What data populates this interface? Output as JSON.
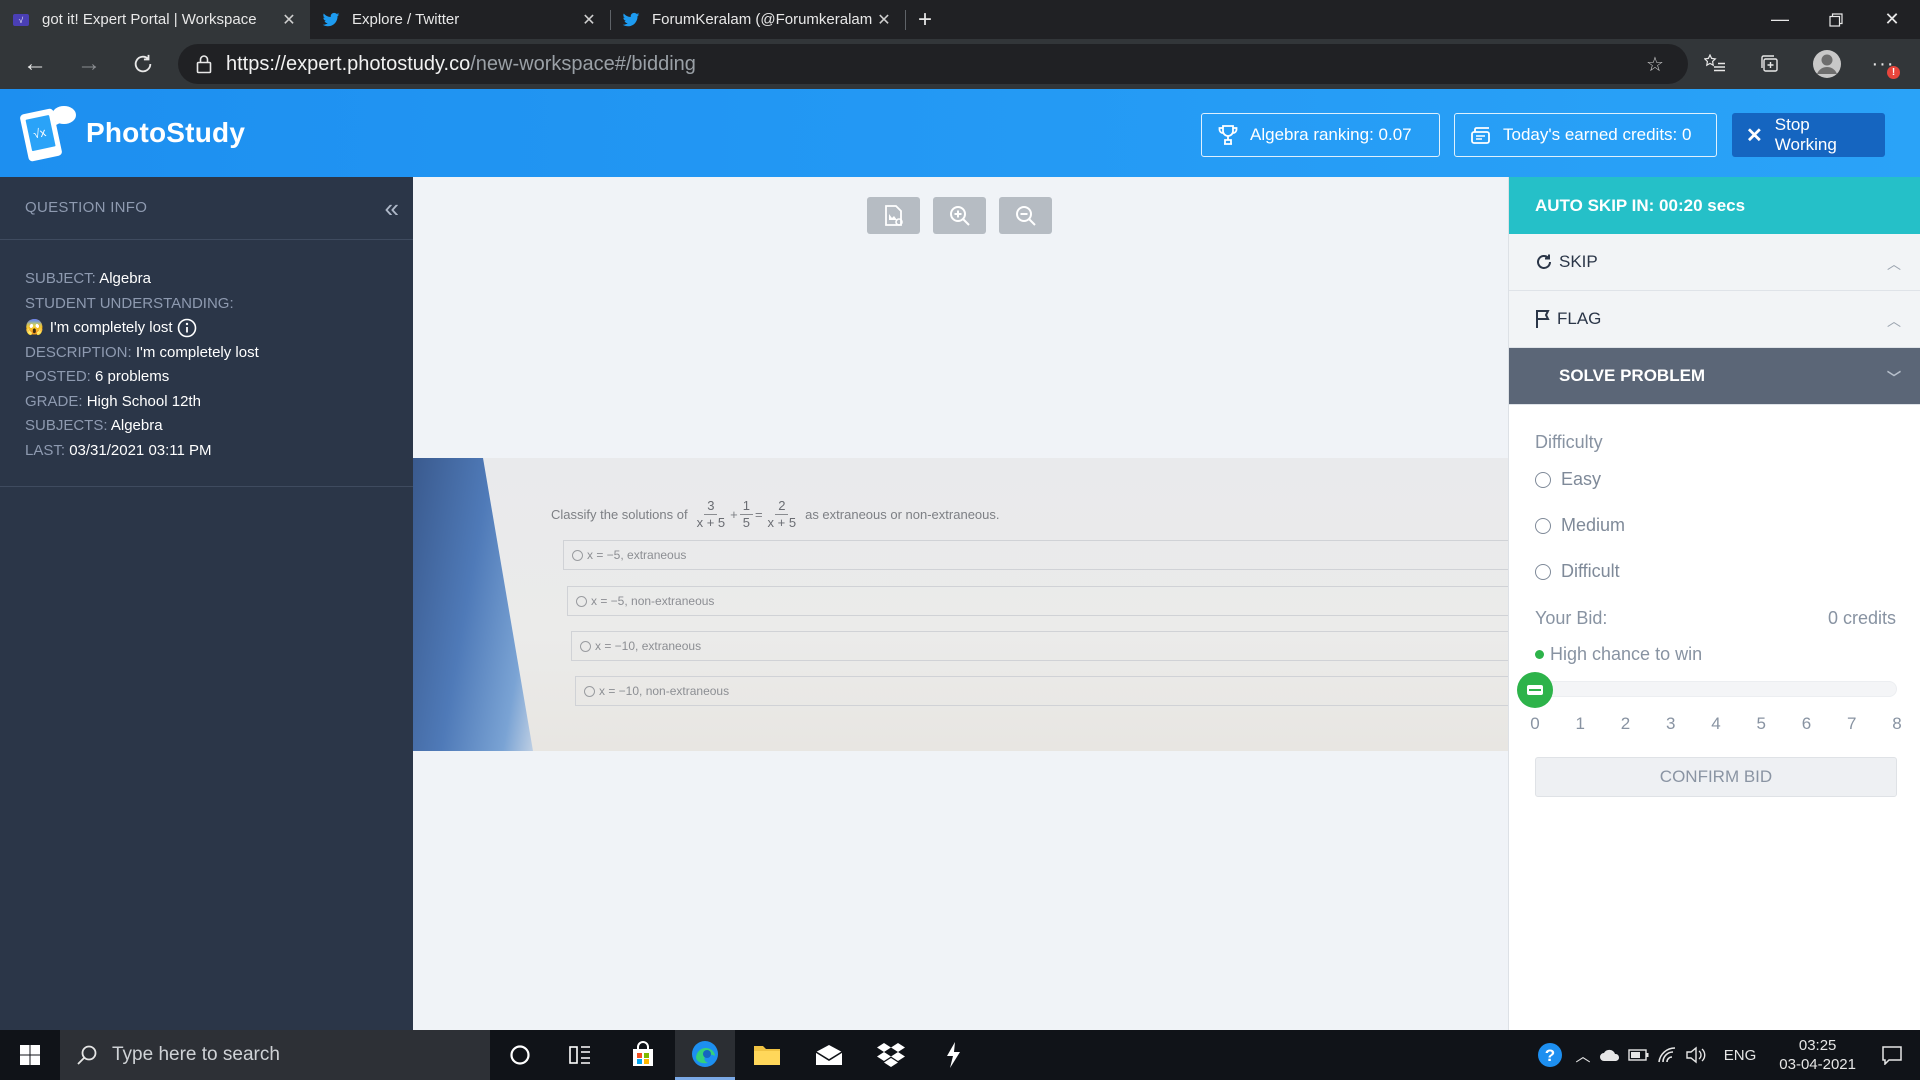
{
  "browser": {
    "tabs": [
      {
        "title": "got it! Expert Portal | Workspace",
        "icon": "gotit-favicon",
        "active": true
      },
      {
        "title": "Explore / Twitter",
        "icon": "twitter-favicon",
        "active": false
      },
      {
        "title": "ForumKeralam (@Forumkeralam",
        "icon": "twitter-favicon",
        "active": false
      }
    ],
    "url_host": "https://expert.photostudy.co",
    "url_path": "/new-workspace#/bidding",
    "notification_badge": "!"
  },
  "app": {
    "name": "PhotoStudy",
    "ranking_label": "Algebra ranking: 0.07",
    "credits_label": "Today's earned credits: 0",
    "stop_label": "Stop Working"
  },
  "question_info": {
    "title": "QUESTION INFO",
    "subject_label": "SUBJECT:",
    "subject_value": "Algebra",
    "understanding_label": "STUDENT UNDERSTANDING:",
    "understanding_value": "I'm completely lost",
    "understanding_emoji": "😱",
    "description_label": "DESCRIPTION:",
    "description_value": "I'm completely lost",
    "posted_label": "POSTED:",
    "posted_value": "6 problems",
    "grade_label": "GRADE:",
    "grade_value": "High School 12th",
    "subjects_label": "SUBJECTS:",
    "subjects_value": "Algebra",
    "last_label": "LAST:",
    "last_value": "03/31/2021 03:11 PM"
  },
  "problem": {
    "prompt_pre": "Classify the solutions of",
    "frac1_num": "3",
    "frac1_den": "x + 5",
    "op1": "+",
    "frac2_num": "1",
    "frac2_den": "5",
    "op2": "=",
    "frac3_num": "2",
    "frac3_den": "x + 5",
    "prompt_post": "as extraneous or non-extraneous.",
    "choices": [
      "x = −5, extraneous",
      "x = −5, non-extraneous",
      "x = −10, extraneous",
      "x = −10, non-extraneous"
    ]
  },
  "right_panel": {
    "auto_skip": "AUTO SKIP IN: 00:20 secs",
    "skip_label": "SKIP",
    "flag_label": "FLAG",
    "solve_label": "SOLVE PROBLEM",
    "difficulty_label": "Difficulty",
    "difficulty_options": [
      "Easy",
      "Medium",
      "Difficult"
    ],
    "bid_label": "Your Bid:",
    "bid_value": "0 credits",
    "chance_label": "High chance to win",
    "slider": {
      "min": 0,
      "max": 8,
      "value": 0,
      "ticks": [
        "0",
        "1",
        "2",
        "3",
        "4",
        "5",
        "6",
        "7",
        "8"
      ]
    },
    "confirm_label": "CONFIRM BID",
    "colors": {
      "autoskip": "#25c0c8",
      "solve_header": "#5b6677",
      "chance": "#2db34a"
    }
  },
  "taskbar": {
    "search_placeholder": "Type here to search",
    "lang": "ENG",
    "time": "03:25",
    "date": "03-04-2021"
  }
}
